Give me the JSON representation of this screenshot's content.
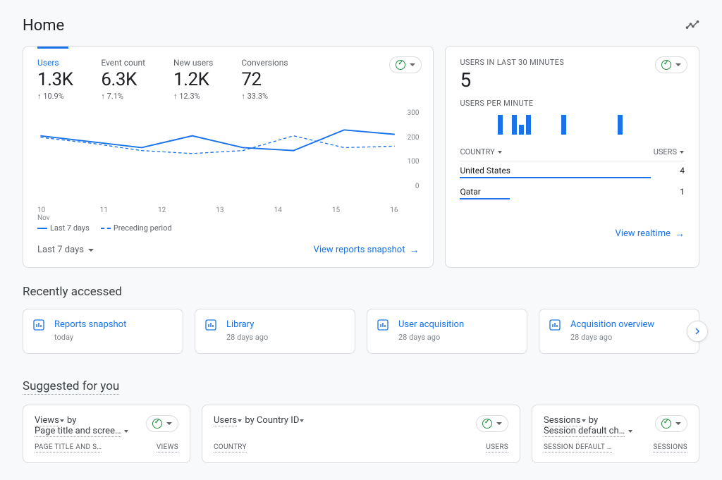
{
  "page": {
    "title": "Home"
  },
  "main_card": {
    "metrics": [
      {
        "label": "Users",
        "value": "1.3K",
        "change": "10.9%",
        "active": true
      },
      {
        "label": "Event count",
        "value": "6.3K",
        "change": "7.1%"
      },
      {
        "label": "New users",
        "value": "1.2K",
        "change": "12.3%"
      },
      {
        "label": "Conversions",
        "value": "72",
        "change": "33.3%"
      }
    ],
    "legend": {
      "a": "Last 7 days",
      "b": "Preceding period"
    },
    "range_dropdown": "Last 7 days",
    "footer_link": "View reports snapshot"
  },
  "chart_data": {
    "type": "line",
    "title": "Users — Last 7 days vs Preceding period",
    "xlabel": "",
    "ylabel": "",
    "ylim": [
      0,
      300
    ],
    "y_ticks": [
      "300",
      "200",
      "100",
      "0"
    ],
    "categories": [
      "10",
      "11",
      "12",
      "13",
      "14",
      "15",
      "16"
    ],
    "x_month_label": "Nov",
    "series": [
      {
        "name": "Last 7 days",
        "values": [
          210,
          190,
          170,
          210,
          170,
          160,
          230,
          215
        ]
      },
      {
        "name": "Preceding period",
        "values": [
          205,
          185,
          160,
          150,
          160,
          210,
          170,
          175
        ]
      }
    ]
  },
  "realtime": {
    "heading": "USERS IN LAST 30 MINUTES",
    "value": "5",
    "sub_heading": "USERS PER MINUTE",
    "bars": [
      0,
      0,
      0,
      0,
      0,
      2,
      0,
      2,
      1,
      2,
      0,
      0,
      0,
      0,
      2,
      0,
      0,
      0,
      0,
      0,
      0,
      0,
      2,
      0,
      0,
      0,
      0,
      0,
      0,
      0
    ],
    "col_country": "COUNTRY",
    "col_users": "USERS",
    "rows": [
      {
        "country": "United States",
        "users": "4",
        "width": 85
      },
      {
        "country": "Qatar",
        "users": "1",
        "width": 22
      }
    ],
    "footer_link": "View realtime"
  },
  "recent": {
    "heading": "Recently accessed",
    "items": [
      {
        "title": "Reports snapshot",
        "sub": "today"
      },
      {
        "title": "Library",
        "sub": "28 days ago"
      },
      {
        "title": "User acquisition",
        "sub": "28 days ago"
      },
      {
        "title": "Acquisition overview",
        "sub": "28 days ago"
      }
    ]
  },
  "suggested": {
    "heading": "Suggested for you",
    "cards": [
      {
        "title_a": "Views",
        "title_b": " by",
        "title_c": "Page title and scree…",
        "col1": "PAGE TITLE AND S…",
        "col2": "VIEWS"
      },
      {
        "title_a": "Users",
        "title_b": " by Country ID",
        "col1": "COUNTRY",
        "col2": "USERS"
      },
      {
        "title_a": "Sessions",
        "title_b": " by",
        "title_c": "Session default ch…",
        "col1": "SESSION DEFAULT …",
        "col2": "SESSIONS"
      }
    ]
  }
}
